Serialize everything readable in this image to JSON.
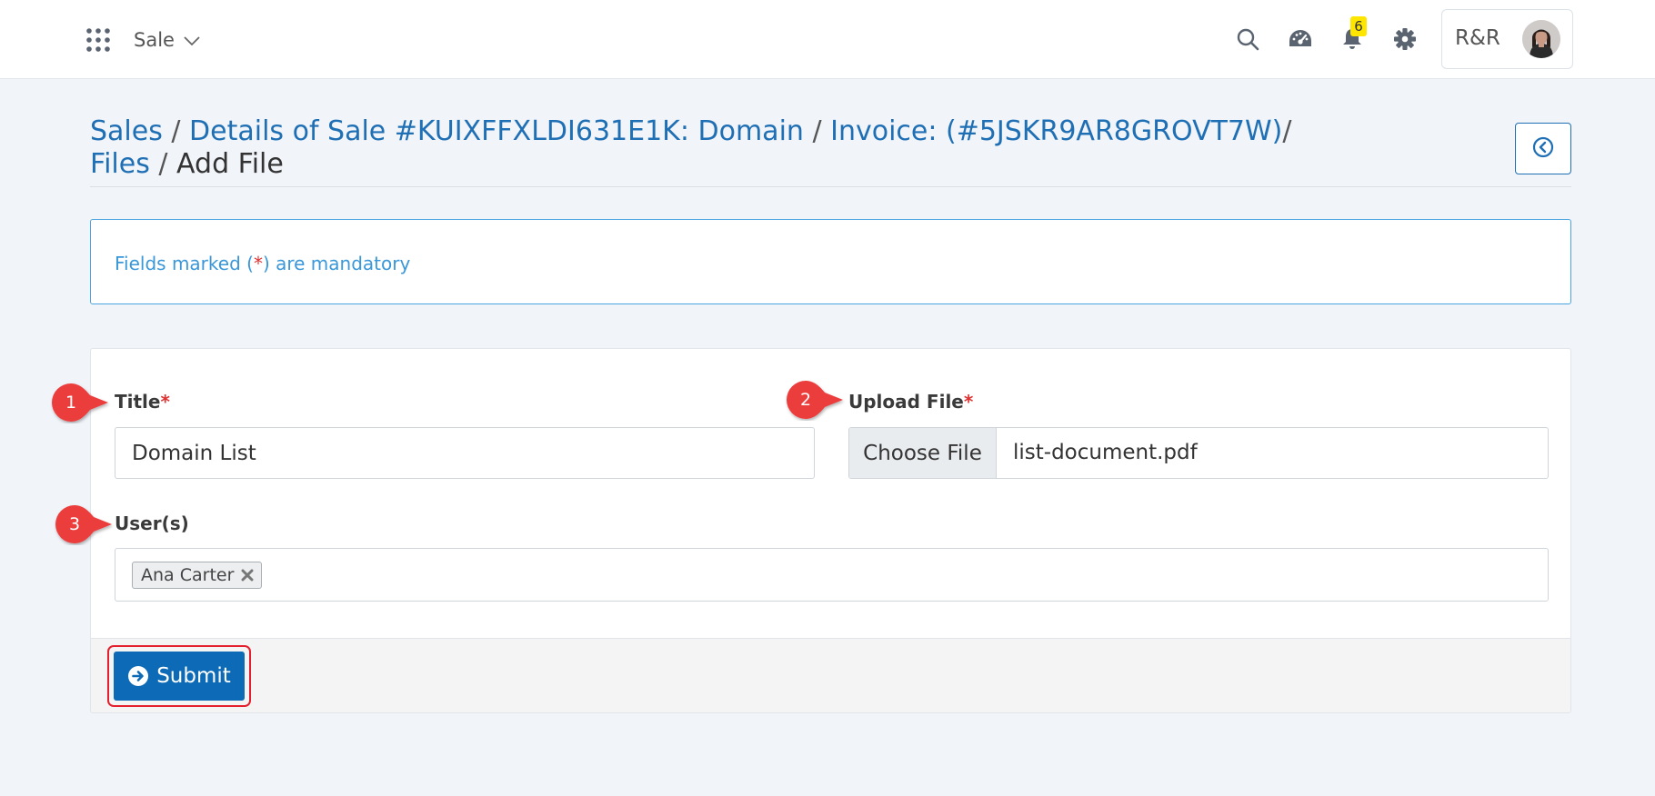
{
  "header": {
    "module_label": "Sale",
    "notification_count": "6",
    "user_initials": "R&R"
  },
  "breadcrumb": {
    "items": [
      "Sales",
      "Details of Sale #KUIXFFXLDI631E1K: Domain",
      "Invoice: (#5JSKR9AR8GROVT7W)",
      "Files"
    ],
    "current": "Add File"
  },
  "info": {
    "prefix": "Fields marked (",
    "required_mark": "*",
    "suffix": ") are mandatory"
  },
  "form": {
    "title_label": "Title",
    "title_value": "Domain List",
    "upload_label": "Upload File",
    "choose_file_label": "Choose File",
    "file_name": "list-document.pdf",
    "users_label": "User(s)",
    "selected_users": [
      "Ana Carter"
    ],
    "required_mark": "*",
    "submit_label": "Submit"
  },
  "markers": [
    "1",
    "2",
    "3"
  ],
  "colors": {
    "link": "#1f6fb5",
    "primary_button": "#0d6ab6",
    "required": "#e03131",
    "info_text": "#3a97d8",
    "marker": "#ec3d3d",
    "highlight": "#e5202e",
    "badge": "#ffe600"
  },
  "icons": [
    "apps-grid-icon",
    "chevron-down-icon",
    "search-icon",
    "dashboard-icon",
    "bell-icon",
    "gear-icon",
    "back-circle-icon",
    "remove-tag-icon",
    "arrow-right-circle-icon"
  ]
}
